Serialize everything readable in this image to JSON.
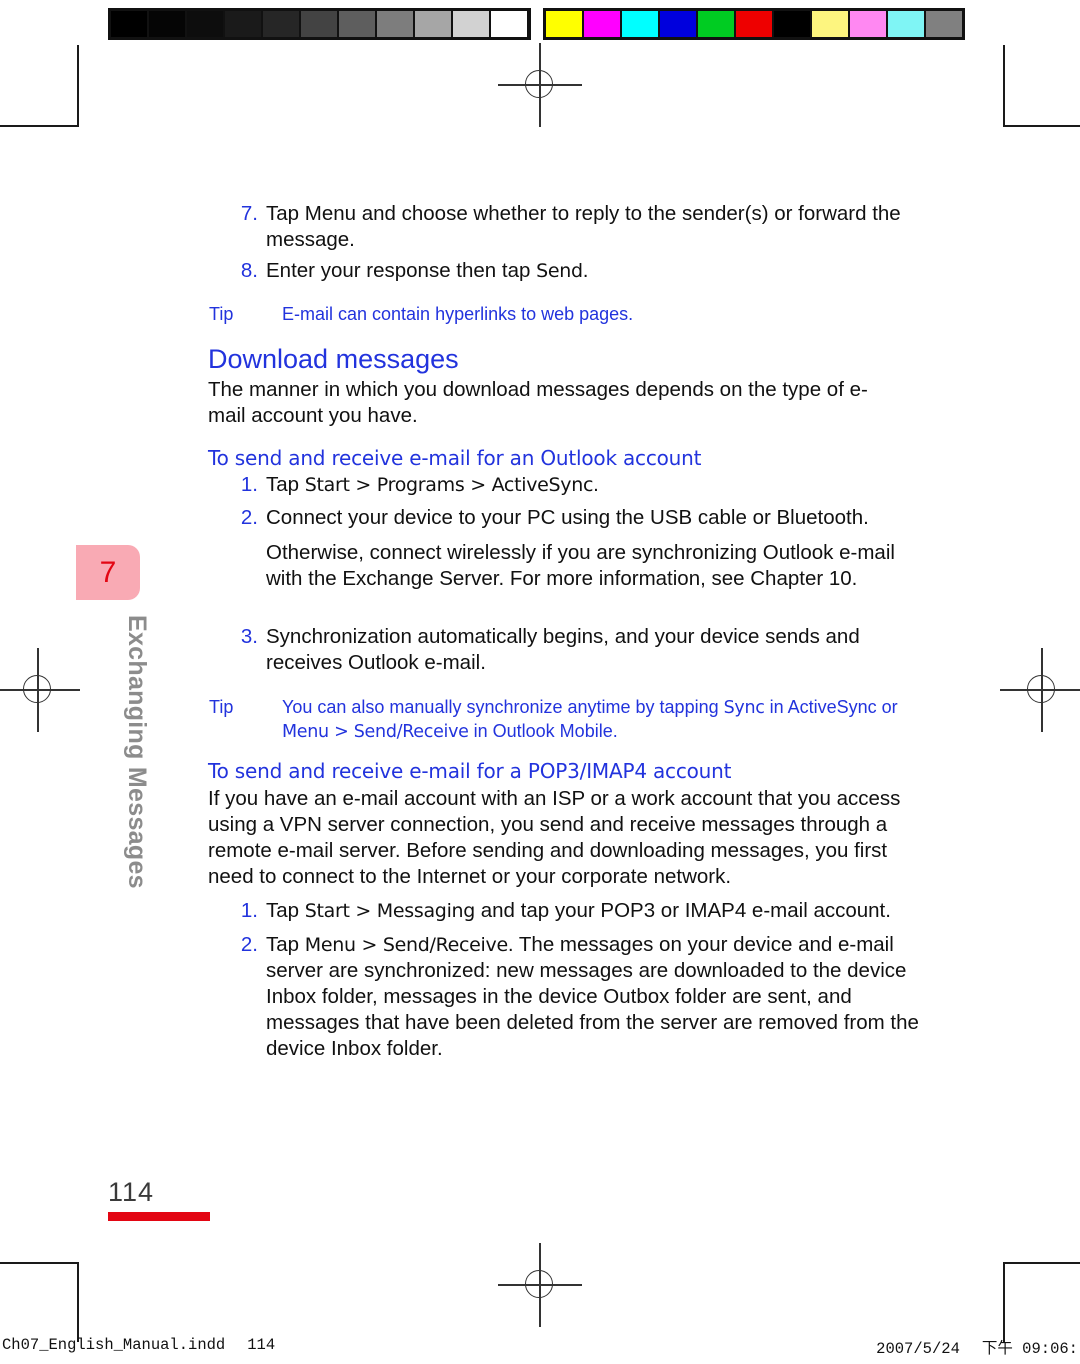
{
  "calibration": {
    "grayscale": [
      "#000000",
      "#050505",
      "#0d0d0d",
      "#1a1a1a",
      "#262626",
      "#434343",
      "#5e5e5e",
      "#7d7d7d",
      "#a6a6a6",
      "#d2d2d2",
      "#ffffff"
    ],
    "colors": [
      "#ffff00",
      "#ff00ff",
      "#00ffff",
      "#0000dd",
      "#00cc22",
      "#ee0000",
      "#000000",
      "#fdf57f",
      "#ff88f2",
      "#7ff5f5",
      "#808080"
    ]
  },
  "chapter": {
    "number": "7",
    "label": "Exchanging Messages",
    "tab_color": "#f9aab4",
    "number_color": "#e30613",
    "label_color": "#8c8c8c"
  },
  "page": {
    "number": "114",
    "accent_color": "#e30613",
    "heading_color": "#2233dd",
    "body_color": "#111111"
  },
  "content": {
    "step7": {
      "marker": "7.",
      "text": "Tap Menu and choose whether to reply to the sender(s) or forward the message."
    },
    "step8": {
      "marker": "8.",
      "text_before": "Enter your response then tap ",
      "ui_term": "Send",
      "text_after": "."
    },
    "tip1": {
      "label": "Tip",
      "text": "E-mail can contain hyperlinks to web pages."
    },
    "section_title": "Download messages",
    "section_intro": "The manner in which you download messages depends on the type of e-mail account you have.",
    "outlook_subtitle": "To send and receive e-mail for an Outlook account",
    "outlook_step1": {
      "marker": "1.",
      "text_before": "Tap ",
      "ui_start": "Start",
      "sep1": " > ",
      "ui_programs": "Programs",
      "sep2": " > ",
      "ui_activesync": "ActiveSync",
      "text_after": "."
    },
    "outlook_step2": {
      "marker": "2.",
      "text": "Connect your device to your PC using the USB cable or Bluetooth."
    },
    "outlook_step2_cont": "Otherwise, connect wirelessly if you are synchronizing Outlook e-mail with the Exchange Server. For more information, see Chapter 10.",
    "outlook_step3": {
      "marker": "3.",
      "text": "Synchronization automatically begins, and your device sends and receives Outlook e-mail."
    },
    "tip2": {
      "label": "Tip",
      "text_1": "You can also manually synchronize anytime by tapping ",
      "ui_sync": "Sync",
      "text_2": " in ActiveSync or ",
      "ui_menu": "Menu",
      "text_3": " > ",
      "ui_sendreceive": "Send/Receive",
      "text_4": " in Outlook Mobile."
    },
    "pop3_subtitle": "To send and receive e-mail for a POP3/IMAP4 account",
    "pop3_intro": "If you have an e-mail account with an ISP or a work account that you access using a VPN server connection, you send and receive messages through a remote e-mail server. Before sending and downloading messages, you first need to connect to the Internet or your corporate network.",
    "pop3_step1": {
      "marker": "1.",
      "text_before": "Tap ",
      "ui_start": "Start",
      "sep1": " > ",
      "ui_messaging": "Messaging",
      "text_after": " and tap your POP3 or IMAP4 e-mail account."
    },
    "pop3_step2": {
      "marker": "2.",
      "text_before": "Tap ",
      "ui_menu": "Menu",
      "sep1": " > ",
      "ui_sendreceive": "Send/Receive",
      "text_after": ". The messages on your device and e-mail server are synchronized: new messages are downloaded to the device Inbox folder, messages in the device Outbox folder are sent, and messages that have been deleted from the server are removed from the device Inbox folder."
    }
  },
  "footer": {
    "filename": "Ch07_English_Manual.indd",
    "page": "114",
    "date": "2007/5/24",
    "time": "下午 09:06:"
  }
}
